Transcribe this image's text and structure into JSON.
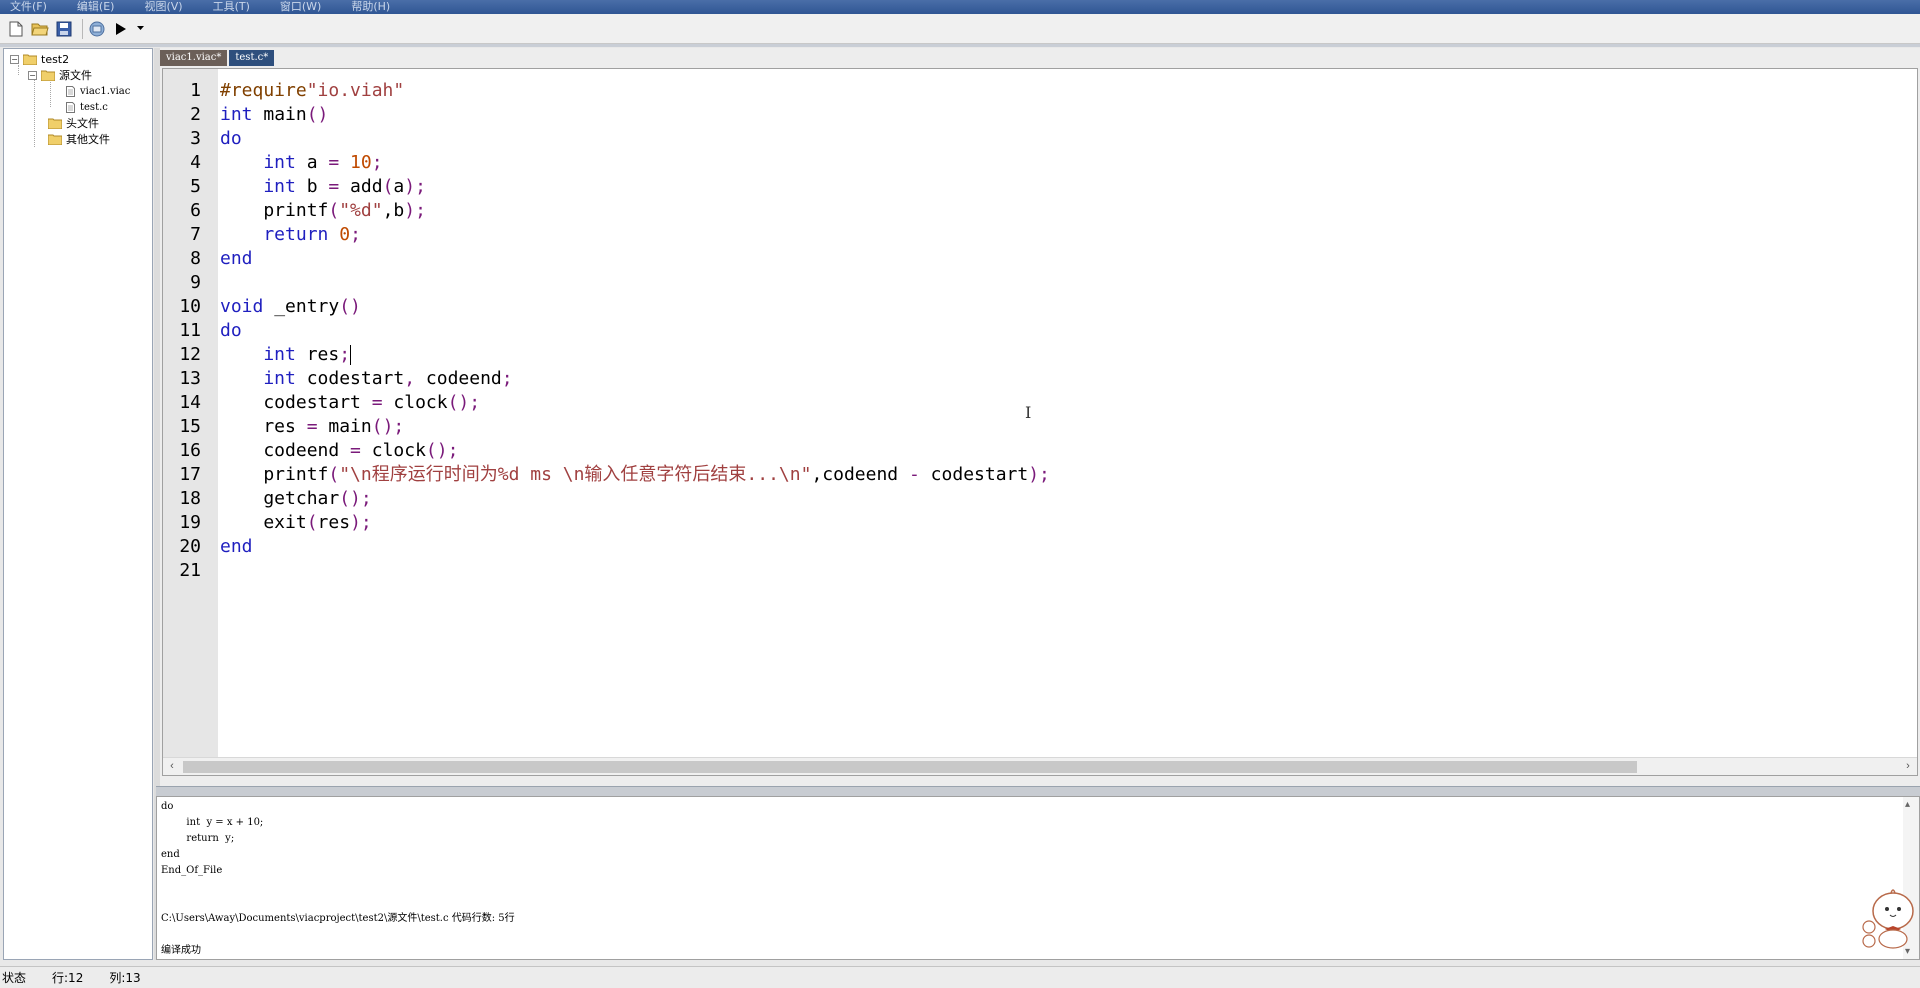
{
  "menu": [
    "文件(F)",
    "编辑(E)",
    "视图(V)",
    "工具(T)",
    "窗口(W)",
    "帮助(H)"
  ],
  "toolbar": {
    "buttons": [
      "new-file",
      "open-folder",
      "save",
      "build",
      "run",
      "run-dropdown"
    ]
  },
  "tree": {
    "root": "test2",
    "source_folder": "源文件",
    "files": [
      "viac1.viac",
      "test.c"
    ],
    "header_folder": "头文件",
    "other_folder": "其他文件"
  },
  "tabs": [
    "viac1.viac*",
    "test.c*"
  ],
  "editor": {
    "line_numbers": [
      "1",
      "2",
      "3",
      "4",
      "5",
      "6",
      "7",
      "8",
      "9",
      "10",
      "11",
      "12",
      "13",
      "14",
      "15",
      "16",
      "17",
      "18",
      "19",
      "20",
      "21"
    ],
    "code": {
      "l1a": "#require",
      "l1b": "\"io.viah\"",
      "l2kw": "int",
      "l2rest": " main",
      "l2p": "()",
      "l3": "do",
      "l4kw": "    int",
      "l4a": " a ",
      "l4op": "=",
      "l4num": " 10",
      "l4sc": ";",
      "l5kw": "    int",
      "l5a": " b ",
      "l5op": "=",
      "l5b": " add",
      "l5p1": "(",
      "l5c": "a",
      "l5p2": ");",
      "l6a": "    printf",
      "l6p1": "(",
      "l6s": "\"%d\"",
      "l6b": ",b",
      "l6p2": ");",
      "l7kw": "    return",
      "l7num": " 0",
      "l7sc": ";",
      "l8": "end",
      "l10kw": "void",
      "l10rest": " _entry",
      "l10p": "()",
      "l11": "do",
      "l12kw": "    int",
      "l12a": " res",
      "l12sc": ";",
      "l13kw": "    int",
      "l13a": " codestart",
      "l13c": ",",
      "l13b": " codeend",
      "l13sc": ";",
      "l14a": "    codestart ",
      "l14op": "=",
      "l14b": " clock",
      "l14p": "();",
      "l15a": "    res ",
      "l15op": "=",
      "l15b": " main",
      "l15p": "();",
      "l16a": "    codeend ",
      "l16op": "=",
      "l16b": " clock",
      "l16p": "();",
      "l17a": "    printf",
      "l17p1": "(",
      "l17s": "\"\\n程序运行时间为%d ms \\n输入任意字符后结束...\\n\"",
      "l17b": ",codeend ",
      "l17op": "-",
      "l17c": " codestart",
      "l17p2": ");",
      "l18a": "    getchar",
      "l18p": "();",
      "l19a": "    exit",
      "l19p1": "(",
      "l19b": "res",
      "l19p2": ");",
      "l20": "end"
    }
  },
  "output": {
    "lines": [
      "do",
      "        int  y = x + 10;",
      "        return  y;",
      "end",
      "End_Of_File",
      "",
      "",
      "C:\\Users\\Away\\Documents\\viacproject\\test2\\源文件\\test.c 代码行数: 5行",
      "",
      "编译成功"
    ]
  },
  "status": {
    "label": "状态",
    "row": "行:12",
    "col": "列:13"
  },
  "colors": {
    "keyword": "#1f1fbf",
    "number": "#c04a00",
    "string": "#a04040",
    "preprocessor": "#804000",
    "operator": "#7a1a7a",
    "menubar": "#2f5694"
  }
}
